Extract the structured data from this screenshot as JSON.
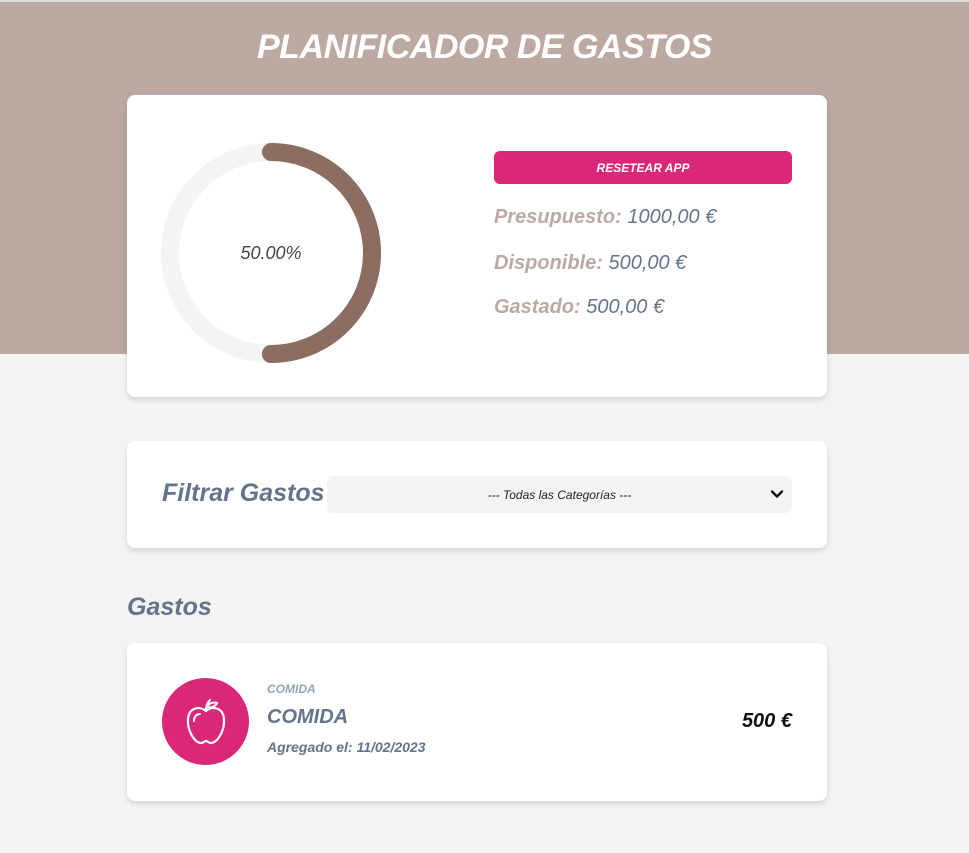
{
  "app": {
    "title": "PLANIFICADOR DE GASTOS"
  },
  "budget": {
    "progress_text": "50.00%",
    "progress_fraction": 0.5,
    "reset_label": "RESETEAR APP",
    "budget_label": "Presupuesto:",
    "budget_value": "1000,00 €",
    "available_label": "Disponible:",
    "available_value": "500,00 €",
    "spent_label": "Gastado:",
    "spent_value": "500,00 €"
  },
  "filter": {
    "label": "Filtrar Gastos",
    "selected": "--- Todas las Categorías ---"
  },
  "expenses_section": {
    "title": "Gastos"
  },
  "expenses": [
    {
      "category": "COMIDA",
      "name": "COMIDA",
      "date": "Agregado el: 11/02/2023",
      "amount": "500 €",
      "icon": "apple-icon"
    }
  ],
  "colors": {
    "header": "#bba9a2",
    "accent": "#db2777",
    "progress": "#8b6d62",
    "track": "#f4f4f4",
    "text_slate": "#64748b"
  }
}
